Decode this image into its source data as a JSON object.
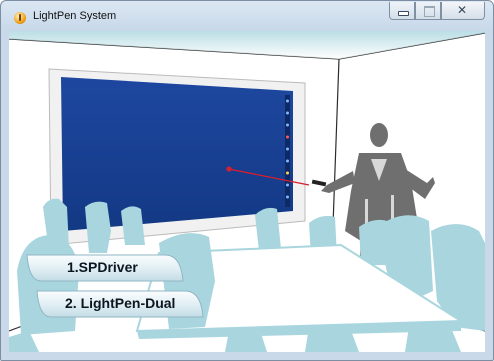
{
  "window": {
    "title": "LightPen System",
    "controls": {
      "minimize_icon": "minimize-icon",
      "maximize_icon": "maximize-icon",
      "close_icon": "close-icon",
      "close_glyph": "✕"
    }
  },
  "menu": [
    {
      "label": "1.SPDriver"
    },
    {
      "label": "2. LightPen-Dual"
    }
  ],
  "colors": {
    "board_blue": "#17408f",
    "silhouette_teal": "#a9d6de",
    "wall_line": "#2c2c2c",
    "laser_red": "#d81e2d"
  }
}
